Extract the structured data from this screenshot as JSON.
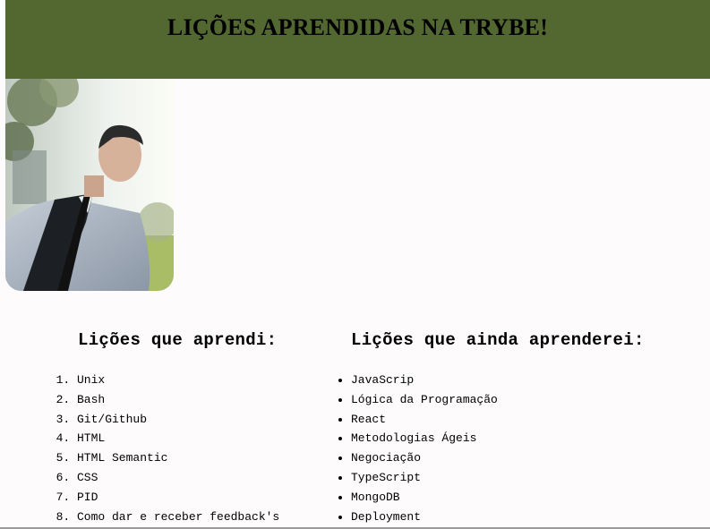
{
  "header": {
    "title": "LIÇÕES APRENDIDAS NA TRYBE!",
    "background_color": "#536830"
  },
  "profile_photo": {
    "icon": "profile-photo"
  },
  "learned": {
    "title": "Lições que aprendi:",
    "items": [
      "Unix",
      "Bash",
      "Git/Github",
      "HTML",
      "HTML Semantic",
      "CSS",
      "PID",
      "Como dar e receber feedback's"
    ]
  },
  "to_learn": {
    "title": "Lições que ainda aprenderei:",
    "items": [
      "JavaScrip",
      "Lógica da Programação",
      "React",
      "Metodologias Ágeis",
      "Negociação",
      "TypeScript",
      "MongoDB",
      "Deployment"
    ]
  }
}
